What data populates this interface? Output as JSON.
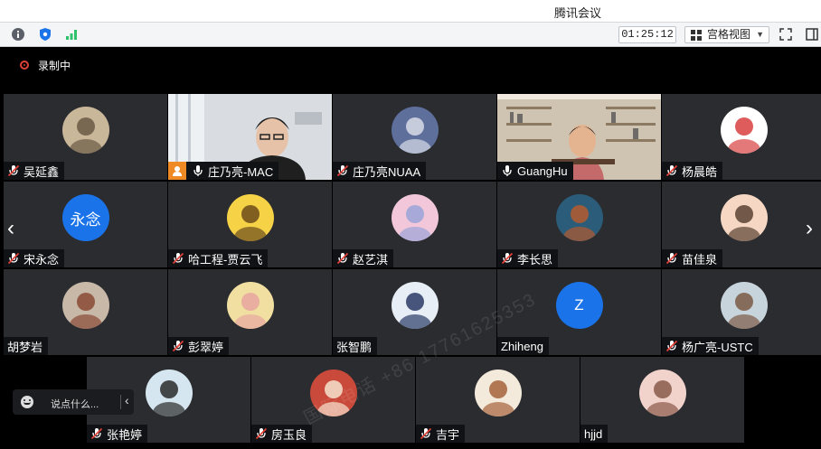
{
  "window": {
    "title": "腾讯会议"
  },
  "toolbar": {
    "timer": "01:25:12",
    "view_label": "宫格视图",
    "icons": [
      "info-icon",
      "shield-icon",
      "signal-icon",
      "fullscreen-icon",
      "sidebar-icon"
    ]
  },
  "recording": {
    "label": "录制中"
  },
  "colors": {
    "accent": "#1a73e8",
    "tile_bg": "#2b2c30",
    "name_bar": "#111215",
    "active_border": "#2ec26a",
    "host_badge": "#f08a24",
    "recording": "#e0403a"
  },
  "participants": [
    {
      "name": "吴延鑫",
      "mic": "muted"
    },
    {
      "name": "庄乃亮-MAC",
      "mic": "on",
      "video": true,
      "host": true,
      "active": true
    },
    {
      "name": "庄乃亮NUAA",
      "mic": "muted"
    },
    {
      "name": "GuangHu",
      "mic": "on",
      "video": true
    },
    {
      "name": "杨晨皓",
      "mic": "muted"
    },
    {
      "name": "宋永念",
      "mic": "muted",
      "initial": "永念"
    },
    {
      "name": "哈工程-贾云飞",
      "mic": "muted"
    },
    {
      "name": "赵艺淇",
      "mic": "muted"
    },
    {
      "name": "李长思",
      "mic": "muted"
    },
    {
      "name": "苗佳泉",
      "mic": "muted"
    },
    {
      "name": "胡梦岩",
      "mic": "none"
    },
    {
      "name": "彭翠婷",
      "mic": "muted"
    },
    {
      "name": "张智鹏",
      "mic": "none"
    },
    {
      "name": "Zhiheng",
      "mic": "none",
      "initial": "Z"
    },
    {
      "name": "杨广亮-USTC",
      "mic": "muted"
    },
    {
      "name": "张艳婷",
      "mic": "muted"
    },
    {
      "name": "房玉良",
      "mic": "muted"
    },
    {
      "name": "吉宇",
      "mic": "muted"
    },
    {
      "name": "hjjd",
      "mic": "none"
    }
  ],
  "chat": {
    "placeholder": "说点什么..."
  },
  "watermark": "国际电话 +86 17761625353"
}
